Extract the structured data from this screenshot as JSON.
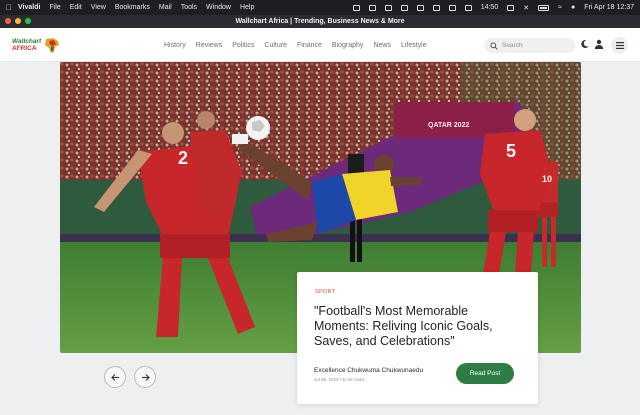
{
  "menubar": {
    "app_name": "Vivaldi",
    "items": [
      "File",
      "Edit",
      "View",
      "Bookmarks",
      "Mail",
      "Tools",
      "Window",
      "Help"
    ],
    "clock_time": "14:50",
    "datetime": "Fri Apr 18  12:37"
  },
  "browser": {
    "window_title": "Wallchart Africa | Trending, Business News & More"
  },
  "site": {
    "logo_line1": "Wallchart",
    "logo_line2": "AFRICA",
    "nav": [
      "History",
      "Reviews",
      "Politics",
      "Culture",
      "Finance",
      "Biography",
      "News",
      "Lifestyle"
    ],
    "search_placeholder": "Search"
  },
  "featured": {
    "category": "SPORT",
    "title": "\"Football's Most Memorable Moments: Reliving Iconic Goals, Saves, and Celebrations\"",
    "author": "Excellence Chukwuma Chukwunaedu",
    "meta": "Jul 09, 2023  •  5 min read",
    "read_label": "Read Post",
    "hero": {
      "player_number_left": "2",
      "player_number_right": "5",
      "player_number_far_right": "10",
      "board_text": "QATAR 2022"
    }
  },
  "colors": {
    "accent_green": "#2d7d45",
    "category_red": "#d94a3d"
  }
}
